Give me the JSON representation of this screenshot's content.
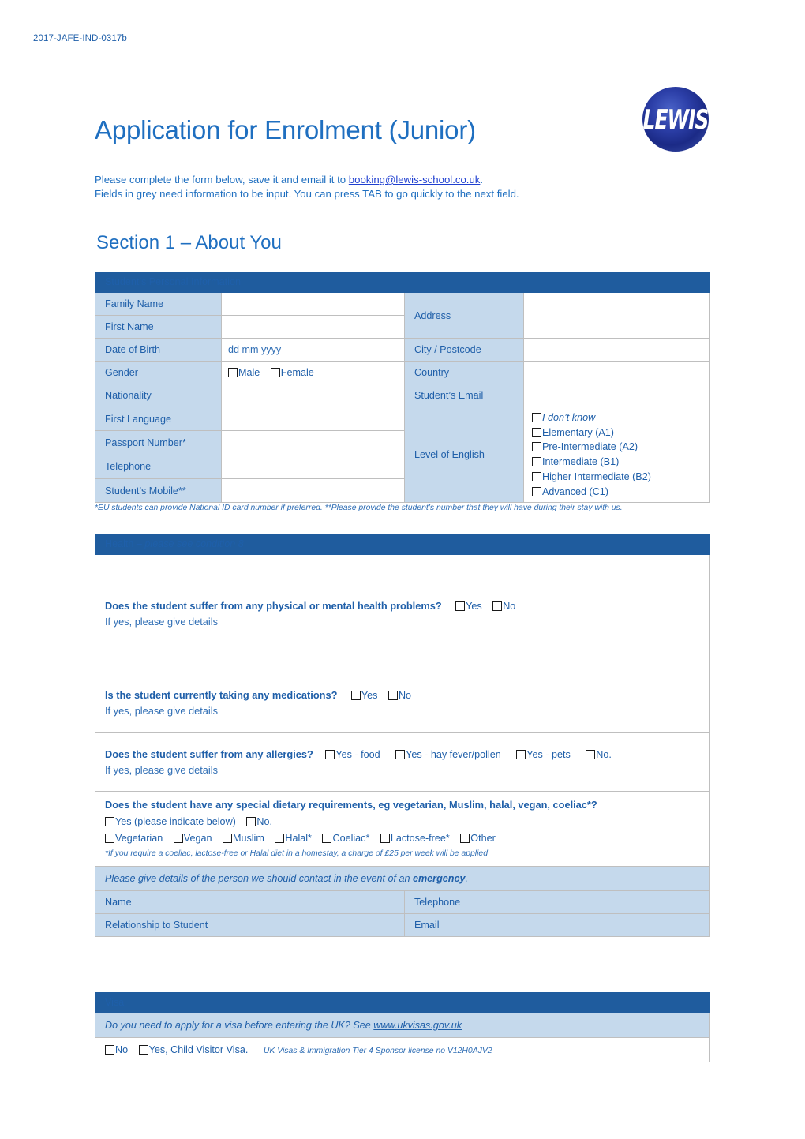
{
  "doc_id": "2017-JAFE-IND-0317b",
  "header": {
    "title": "Application for Enrolment (Junior)",
    "logo_text": "LEWIS"
  },
  "intro": {
    "line1_before": "Please complete the form below, save it and email it to ",
    "email": "booking@lewis-school.co.uk",
    "line1_after": ".",
    "line2": "Fields in grey need information to be input. You can press TAB to go quickly to the next field."
  },
  "section": {
    "heading": "Section 1 – About You"
  },
  "personal": {
    "bar": "Student’s Personal Information",
    "labels": {
      "family_name": "Family Name",
      "first_name": "First Name",
      "date_of_birth": "Date of Birth",
      "gender": "Gender",
      "nationality": "Nationality",
      "first_language": "First Language",
      "passport_number": "Passport Number*",
      "telephone": "Telephone",
      "student_mobile": "Student’s Mobile**",
      "address": "Address",
      "city_postcode": "City / Postcode",
      "country": "Country",
      "student_email": "Student’s Email",
      "level_of_english": "Level of English"
    },
    "values": {
      "family_name": "",
      "first_name": "",
      "date_of_birth": "dd  mm  yyyy",
      "nationality": "",
      "first_language": "",
      "passport_number": "",
      "telephone": "",
      "student_mobile": "",
      "address": "",
      "city_postcode": "",
      "country": "",
      "student_email": ""
    },
    "gender_options": [
      "Male",
      "Female"
    ],
    "english_levels": [
      {
        "label": "I don’t know",
        "italic": true
      },
      {
        "label": "Elementary (A1)",
        "italic": false
      },
      {
        "label": "Pre-Intermediate (A2)",
        "italic": false
      },
      {
        "label": "Intermediate (B1)",
        "italic": false
      },
      {
        "label": "Higher Intermediate (B2)",
        "italic": false
      },
      {
        "label": "Advanced (C1)",
        "italic": false
      }
    ],
    "footnote": "*EU students can provide National ID card number if preferred. **Please provide the student’s number that they will have during their stay with us."
  },
  "health": {
    "bar_title": "Health – ",
    "bar_italic": "please see condition 8",
    "q1": {
      "question": "Does the student suffer from any physical or mental health problems?",
      "options": [
        "Yes",
        "No"
      ],
      "sub": "If yes, please give details"
    },
    "q2": {
      "question": "Is the student currently taking any medications?",
      "options": [
        "Yes",
        "No"
      ],
      "sub": "If yes, please give details"
    },
    "q3": {
      "question": "Does the student suffer from any allergies?",
      "options": [
        "Yes - food",
        "Yes - hay fever/pollen",
        "Yes - pets",
        "No."
      ],
      "sub": "If yes, please give details"
    },
    "q4": {
      "question": "Does the student have any special dietary requirements, eg vegetarian, Muslim, halal, vegan, coeliac*?",
      "yesno": [
        "Yes (please indicate below)",
        "No."
      ],
      "diets": [
        "Vegetarian",
        "Vegan",
        "Muslim",
        "Halal*",
        "Coeliac*",
        "Lactose-free*",
        "Other"
      ],
      "note": "*If you require a coeliac, lactose-free or Halal diet in a homestay, a charge of £25 per week will be applied"
    },
    "emergency": {
      "intro_before": "Please give details of the person we should contact in the event of an ",
      "intro_bold": "emergency",
      "intro_after": ".",
      "name_label": "Name",
      "telephone_label": "Telephone",
      "relationship_label": "Relationship to Student",
      "email_label": "Email",
      "name_value": "",
      "telephone_value": "",
      "relationship_value": "",
      "email_value": ""
    }
  },
  "visa": {
    "bar": "Visa",
    "note_before": "Do you need to apply for a visa before entering the UK? See ",
    "note_link": "www.ukvisas.gov.uk",
    "options": [
      "No",
      "Yes, Child Visitor Visa."
    ],
    "license": "UK Visas & Immigration Tier 4 Sponsor license no V12H0AJV2"
  },
  "colors": {
    "header_bar": "#1F5C9E",
    "label_bg": "#C5D9EC",
    "text_blue": "#1F5FA9",
    "title_blue": "#1F6FC0",
    "border": "#bfbfbf",
    "link": "#1F3FD0"
  }
}
